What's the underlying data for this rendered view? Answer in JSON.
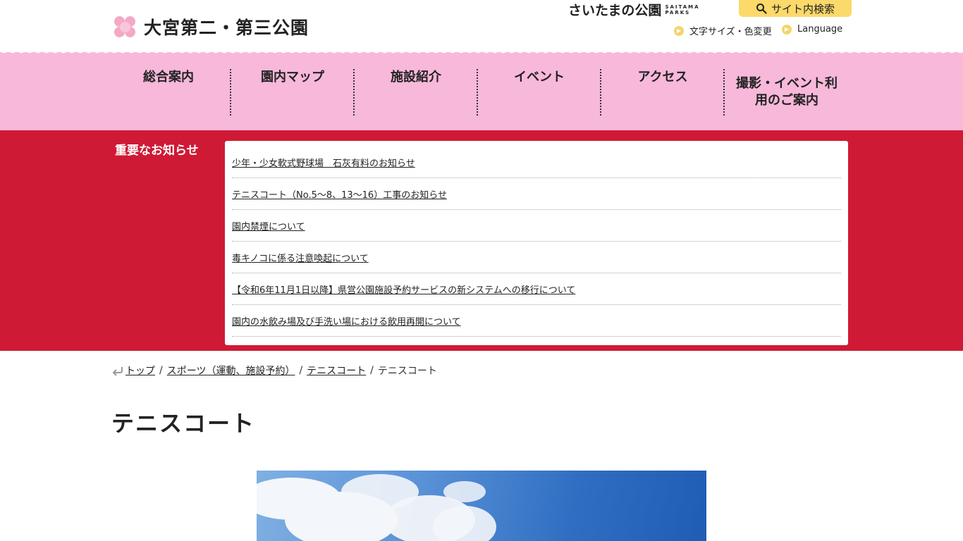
{
  "header": {
    "site_title": "大宮第二・第三公園",
    "brand_jp": "さいたまの公園",
    "brand_en_line1": "SAITAMA",
    "brand_en_line2": "PARKS",
    "search_label": "サイト内検索",
    "font_color_link": "文字サイズ・色変更",
    "language_link": "Language"
  },
  "nav": {
    "items": [
      {
        "label": "総合案内"
      },
      {
        "label": "園内マップ"
      },
      {
        "label": "施設紹介"
      },
      {
        "label": "イベント"
      },
      {
        "label": "アクセス"
      },
      {
        "label_line1": "撮影・イベント利",
        "label_line2": "用のご案内"
      }
    ]
  },
  "notices": {
    "heading": "重要なお知らせ",
    "items": [
      "少年・少女軟式野球場　石灰有料のお知らせ",
      "テニスコート（No.5～8、13～16）工事のお知らせ",
      "園内禁煙について",
      "毒キノコに係る注意喚起について",
      "【令和6年11月1日以降】県営公園施設予約サービスの新システムへの移行について",
      "園内の水飲み場及び手洗い場における飲用再開について"
    ]
  },
  "breadcrumb": {
    "items": [
      "トップ",
      "スポーツ（運動、施設予約）",
      "テニスコート"
    ],
    "current": "テニスコート"
  },
  "page": {
    "title": "テニスコート"
  },
  "colors": {
    "nav_bg": "#f8b8da",
    "notice_bg": "#cf1a35",
    "search_btn": "#fbd96b",
    "sakura": "#f4a9c6"
  },
  "icons": [
    "sakura-logo-icon",
    "search-icon",
    "chevron-right-icon",
    "return-arrow-icon"
  ]
}
